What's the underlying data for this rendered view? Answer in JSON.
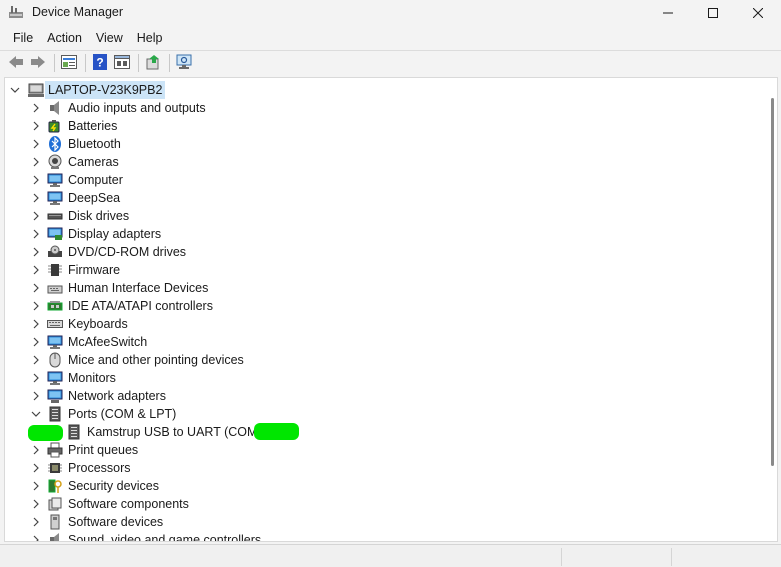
{
  "window": {
    "title": "Device Manager",
    "controls": {
      "minimize": "—",
      "maximize": "□",
      "close": "✕"
    }
  },
  "menu": [
    "File",
    "Action",
    "View",
    "Help"
  ],
  "toolbar": {
    "buttons": [
      "back-icon",
      "forward-icon",
      "properties-icon",
      "help-icon",
      "show-hide-icon",
      "update-driver-icon",
      "scan-hardware-icon"
    ]
  },
  "tree": {
    "root": {
      "label": "LAPTOP-V23K9PB2",
      "expanded": true
    },
    "categories": [
      {
        "label": "Audio inputs and outputs",
        "icon": "speaker-icon",
        "expanded": false
      },
      {
        "label": "Batteries",
        "icon": "battery-icon",
        "expanded": false
      },
      {
        "label": "Bluetooth",
        "icon": "bluetooth-icon",
        "expanded": false
      },
      {
        "label": "Cameras",
        "icon": "camera-icon",
        "expanded": false
      },
      {
        "label": "Computer",
        "icon": "monitor-icon",
        "expanded": false
      },
      {
        "label": "DeepSea",
        "icon": "monitor-icon",
        "expanded": false
      },
      {
        "label": "Disk drives",
        "icon": "disk-drive-icon",
        "expanded": false
      },
      {
        "label": "Display adapters",
        "icon": "display-adapter-icon",
        "expanded": false
      },
      {
        "label": "DVD/CD-ROM drives",
        "icon": "optical-drive-icon",
        "expanded": false
      },
      {
        "label": "Firmware",
        "icon": "chip-icon",
        "expanded": false
      },
      {
        "label": "Human Interface Devices",
        "icon": "hid-icon",
        "expanded": false
      },
      {
        "label": "IDE ATA/ATAPI controllers",
        "icon": "controller-icon",
        "expanded": false
      },
      {
        "label": "Keyboards",
        "icon": "keyboard-icon",
        "expanded": false
      },
      {
        "label": "McAfeeSwitch",
        "icon": "monitor-icon",
        "expanded": false
      },
      {
        "label": "Mice and other pointing devices",
        "icon": "mouse-icon",
        "expanded": false
      },
      {
        "label": "Monitors",
        "icon": "monitor-icon",
        "expanded": false
      },
      {
        "label": "Network adapters",
        "icon": "network-icon",
        "expanded": false
      },
      {
        "label": "Ports (COM & LPT)",
        "icon": "port-icon",
        "expanded": true
      },
      {
        "label": "Kamstrup USB to UART (COM7)",
        "icon": "port-icon",
        "child": true
      },
      {
        "label": "Print queues",
        "icon": "printer-icon",
        "expanded": false
      },
      {
        "label": "Processors",
        "icon": "processor-icon",
        "expanded": false
      },
      {
        "label": "Security devices",
        "icon": "security-key-icon",
        "expanded": false
      },
      {
        "label": "Software components",
        "icon": "software-component-icon",
        "expanded": false
      },
      {
        "label": "Software devices",
        "icon": "software-device-icon",
        "expanded": false
      },
      {
        "label": "Sound, video and game controllers",
        "icon": "speaker-icon",
        "expanded": false
      }
    ]
  },
  "colors": {
    "selection": "#cce4f7",
    "accent": "#0067c0",
    "highlight_blob": "#00e600"
  }
}
